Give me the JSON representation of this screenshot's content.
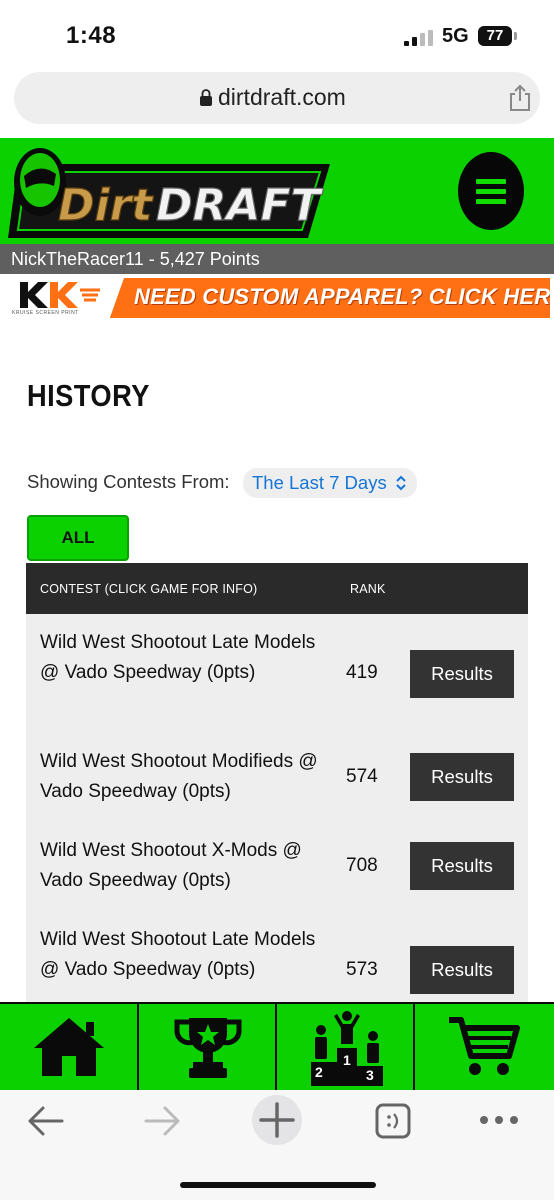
{
  "status_bar": {
    "time": "1:48",
    "network": "5G",
    "battery": "77"
  },
  "browser": {
    "url": "dirtdraft.com"
  },
  "header": {
    "logo_text_left": "Dirt",
    "logo_text_right": "DRAFT",
    "user_info": "NickTheRacer11 - 5,427 Points"
  },
  "banner": {
    "text": "NEED CUSTOM APPAREL? CLICK HERE!",
    "brand_mark": "KK",
    "brand_caption": "KRUISE SCREEN PRINT"
  },
  "page": {
    "title": "HISTORY"
  },
  "filter": {
    "label": "Showing Contests From:",
    "value": "The Last 7 Days",
    "all_button": "ALL"
  },
  "table": {
    "headers": [
      "CONTEST (CLICK GAME FOR INFO)",
      "RANK"
    ],
    "rows": [
      {
        "contest": "Wild West Shootout Late Models @ Vado Speedway (0pts)",
        "rank": "419",
        "action": "Results"
      },
      {
        "contest": "Wild West Shootout Modifieds @ Vado Speedway (0pts)",
        "rank": "574",
        "action": "Results"
      },
      {
        "contest": "Wild West Shootout X-Mods @ Vado Speedway (0pts)",
        "rank": "708",
        "action": "Results"
      },
      {
        "contest": "Wild West Shootout Late Models @ Vado Speedway (0pts)",
        "rank": "573",
        "action": "Results"
      }
    ]
  },
  "bottom_nav": {
    "items": [
      "home-icon",
      "trophy-icon",
      "leaderboard-podium-icon",
      "cart-icon"
    ],
    "podium_numbers": [
      "2",
      "1",
      "3"
    ]
  },
  "colors": {
    "brand_green": "#0bd100",
    "banner_orange": "#ff6f13",
    "link_blue": "#1475d6",
    "dark": "#2a2a2a"
  }
}
